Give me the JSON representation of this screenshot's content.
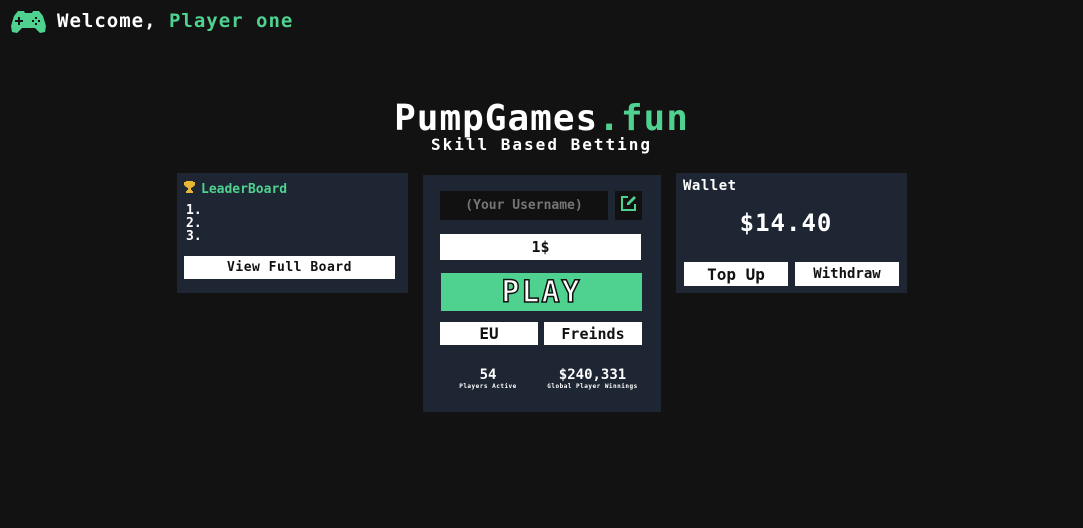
{
  "header": {
    "greeting": "Welcome, ",
    "player_name": "Player one",
    "logo_icon": "gamepad-icon"
  },
  "brand": {
    "title_main": "PumpGames",
    "title_accent": ".fun",
    "subtitle": "Skill Based Betting"
  },
  "leaderboard": {
    "title": "LeaderBoard",
    "icon": "trophy-icon",
    "entries": [
      "1.",
      "2.",
      "3."
    ],
    "view_full_label": "View Full Board"
  },
  "game": {
    "username_placeholder": "(Your Username)",
    "edit_icon": "edit-icon",
    "bet_amount": "1$",
    "play_label": "PLAY",
    "region_label": "EU",
    "friends_label": "Freinds",
    "stats": {
      "players_active_value": "54",
      "players_active_label": "Players Active",
      "global_winnings_value": "$240,331",
      "global_winnings_label": "Global Player Winnings"
    }
  },
  "wallet": {
    "title": "Wallet",
    "balance": "$14.40",
    "top_up_label": "Top Up",
    "withdraw_label": "Withdraw"
  },
  "colors": {
    "background": "#121212",
    "panel": "#1e2633",
    "accent": "#4fd18f",
    "input_dark": "#111111"
  }
}
